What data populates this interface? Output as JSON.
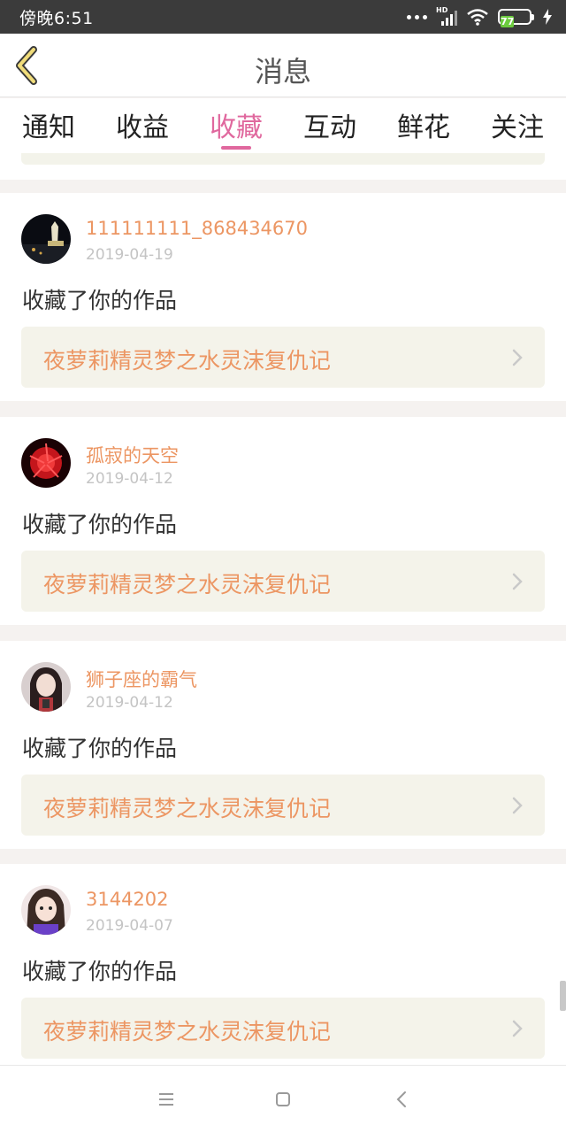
{
  "status_bar": {
    "time": "傍晚6:51",
    "network_label": "HD",
    "battery_level": "77"
  },
  "header": {
    "title": "消息",
    "back_icon": "chevron-left-icon"
  },
  "tabs": [
    {
      "label": "通知",
      "active": false
    },
    {
      "label": "收益",
      "active": false
    },
    {
      "label": "收藏",
      "active": true
    },
    {
      "label": "互动",
      "active": false
    },
    {
      "label": "鲜花",
      "active": false
    },
    {
      "label": "关注",
      "active": false
    }
  ],
  "items": [
    {
      "username": "111111111_868434670",
      "date": "2019-04-19",
      "action": "收藏了你的作品",
      "work_title": "夜萝莉精灵梦之水灵沫复仇记"
    },
    {
      "username": "孤寂的天空",
      "date": "2019-04-12",
      "action": "收藏了你的作品",
      "work_title": "夜萝莉精灵梦之水灵沫复仇记"
    },
    {
      "username": "狮子座的霸气",
      "date": "2019-04-12",
      "action": "收藏了你的作品",
      "work_title": "夜萝莉精灵梦之水灵沫复仇记"
    },
    {
      "username": "3144202",
      "date": "2019-04-07",
      "action": "收藏了你的作品",
      "work_title": "夜萝莉精灵梦之水灵沫复仇记"
    }
  ],
  "colors": {
    "accent": "#e0689e",
    "name_text": "#ec9663",
    "card_bg": "#f4f3ea",
    "back_icon": "#d6a74a"
  },
  "system_nav": {
    "icons": [
      "menu-icon",
      "home-icon",
      "back-icon"
    ]
  }
}
